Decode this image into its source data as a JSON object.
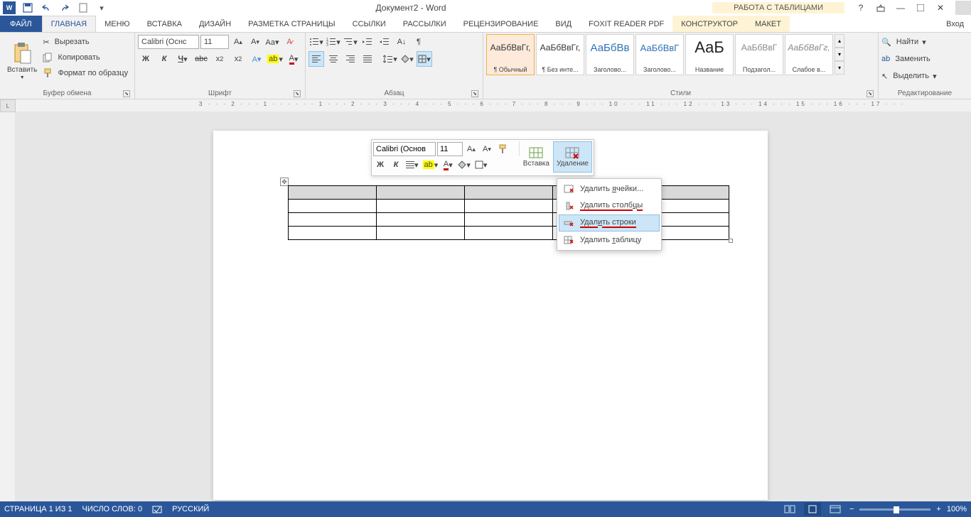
{
  "title": "Документ2 - Word",
  "table_tools_label": "РАБОТА С ТАБЛИЦАМИ",
  "tabs": {
    "file": "ФАЙЛ",
    "home": "ГЛАВНАЯ",
    "menu": "Меню",
    "insert": "ВСТАВКА",
    "design": "ДИЗАЙН",
    "layout": "РАЗМЕТКА СТРАНИЦЫ",
    "references": "ССЫЛКИ",
    "mailings": "РАССЫЛКИ",
    "review": "РЕЦЕНЗИРОВАНИЕ",
    "view": "ВИД",
    "foxit": "Foxit Reader PDF",
    "constructor": "КОНСТРУКТОР",
    "tlayout": "МАКЕТ",
    "signin": "Вход"
  },
  "clipboard": {
    "paste": "Вставить",
    "cut": "Вырезать",
    "copy": "Копировать",
    "painter": "Формат по образцу",
    "group": "Буфер обмена"
  },
  "font": {
    "name": "Calibri (Оснс",
    "size": "11",
    "group": "Шрифт",
    "bold": "Ж",
    "italic": "К",
    "underline": "Ч"
  },
  "paragraph": {
    "group": "Абзац"
  },
  "styles": {
    "group": "Стили",
    "items": [
      {
        "preview": "АаБбВвГг,",
        "label": "¶ Обычный"
      },
      {
        "preview": "АаБбВвГг,",
        "label": "¶ Без инте..."
      },
      {
        "preview": "АаБбВв",
        "label": "Заголово..."
      },
      {
        "preview": "АаБбВвГ",
        "label": "Заголово..."
      },
      {
        "preview": "АаБ",
        "label": "Название"
      },
      {
        "preview": "АаБбВвГ",
        "label": "Подзагол..."
      },
      {
        "preview": "АаБбВвГг,",
        "label": "Слабое в..."
      }
    ]
  },
  "editing": {
    "find": "Найти",
    "replace": "Заменить",
    "select": "Выделить",
    "group": "Редактирование"
  },
  "minibar": {
    "font": "Calibri (Основ",
    "size": "11",
    "insert": "Вставка",
    "delete": "Удаление",
    "bold": "Ж",
    "italic": "К"
  },
  "dropdown": {
    "cells": "Удалить ячейки...",
    "cols": "Удалить столбцы",
    "rows": "Удалить строки",
    "table": "Удалить таблицу"
  },
  "status": {
    "page": "СТРАНИЦА 1 ИЗ 1",
    "words": "ЧИСЛО СЛОВ: 0",
    "lang": "РУССКИЙ",
    "zoom": "100%"
  },
  "ruler": "3 · · · 2 · · · 1 · · ·   · · · 1 · · · 2 · · · 3 · · · 4 · · · 5 · · · 6 · · · 7 · · · 8 · · · 9 · · · 10 · · · 11 · · · 12 · · · 13 · · · 14 · · · 15 · · · 16 · · · 17 · · ·"
}
